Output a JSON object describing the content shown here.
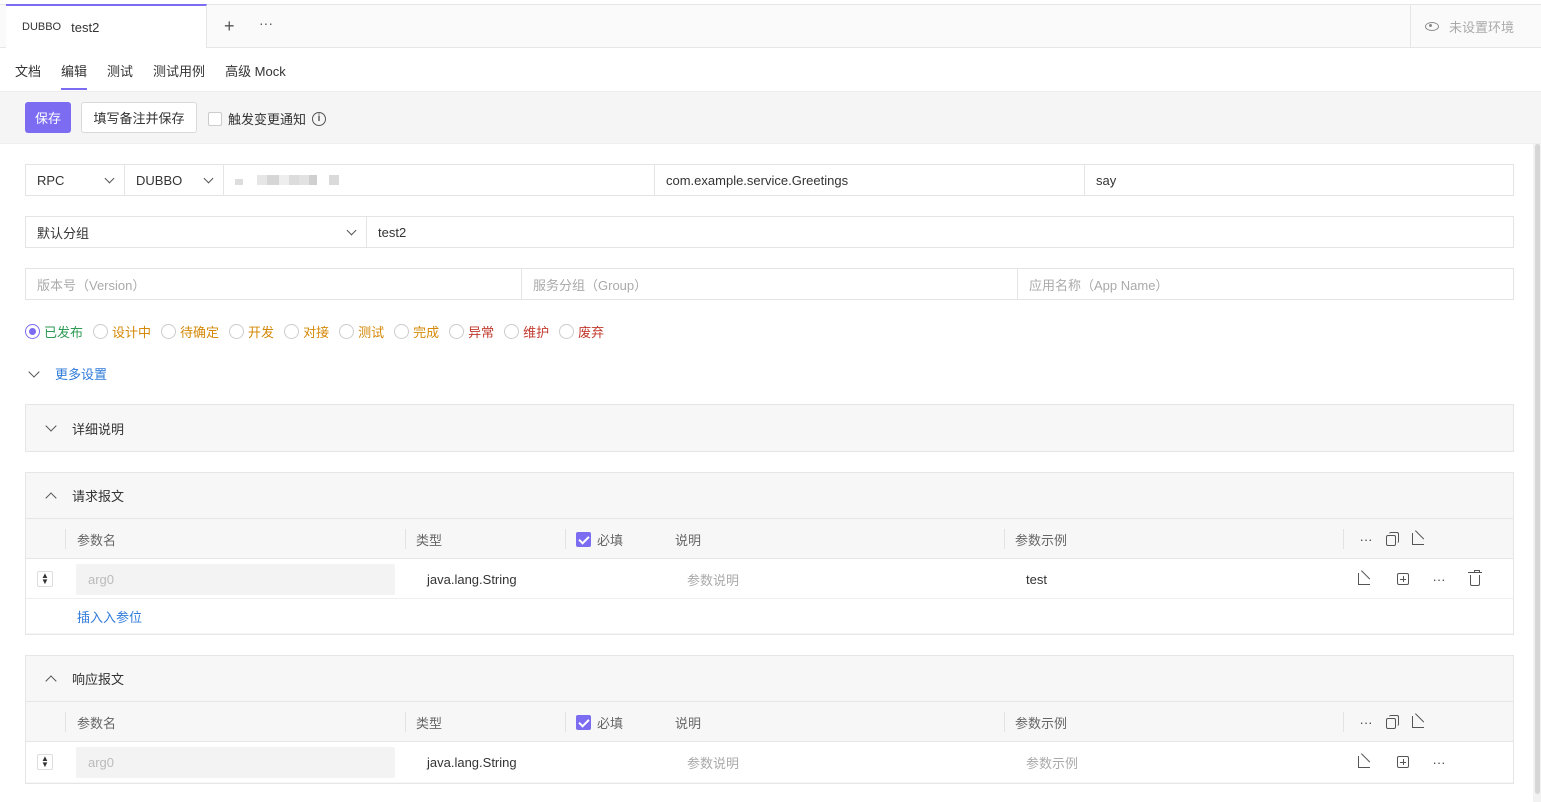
{
  "tab": {
    "protocol": "DUBBO",
    "name": "test2",
    "add": "+",
    "more": "···"
  },
  "env": {
    "label": "未设置环境"
  },
  "subtabs": [
    "文档",
    "编辑",
    "测试",
    "测试用例",
    "高级 Mock"
  ],
  "toolbar": {
    "save": "保存",
    "save_with_note": "填写备注并保存",
    "notify": "触发变更通知",
    "info": "i"
  },
  "endpoint": {
    "type": "RPC",
    "protocol": "DUBBO",
    "interface": "com.example.service.Greetings",
    "method": "say"
  },
  "group": {
    "selected": "默认分组",
    "name": "test2"
  },
  "meta": {
    "version_placeholder": "版本号（Version）",
    "group_placeholder": "服务分组（Group）",
    "app_placeholder": "应用名称（App Name）"
  },
  "statuses": [
    {
      "label": "已发布",
      "color": "#2b9a52",
      "checked": true
    },
    {
      "label": "设计中",
      "color": "#d48806"
    },
    {
      "label": "待确定",
      "color": "#d48806"
    },
    {
      "label": "开发",
      "color": "#d48806"
    },
    {
      "label": "对接",
      "color": "#d48806"
    },
    {
      "label": "测试",
      "color": "#d48806"
    },
    {
      "label": "完成",
      "color": "#d48806"
    },
    {
      "label": "异常",
      "color": "#c0392b"
    },
    {
      "label": "维护",
      "color": "#c0392b"
    },
    {
      "label": "废弃",
      "color": "#c0392b"
    }
  ],
  "more_settings": "更多设置",
  "detail": {
    "title": "详细说明"
  },
  "columns": {
    "name": "参数名",
    "type": "类型",
    "required": "必填",
    "desc": "说明",
    "example": "参数示例",
    "more": "···"
  },
  "request": {
    "title": "请求报文",
    "rows": [
      {
        "name": "arg0",
        "type": "java.lang.String",
        "desc": "参数说明",
        "example": "test",
        "more": "···"
      }
    ],
    "insert": "插入入参位"
  },
  "response": {
    "title": "响应报文",
    "rows": [
      {
        "name": "arg0",
        "type": "java.lang.String",
        "desc": "参数说明",
        "example": "参数示例",
        "more": "···"
      }
    ]
  },
  "colors": {
    "accent": "#7b6cf2",
    "link": "#2f7bd9"
  }
}
